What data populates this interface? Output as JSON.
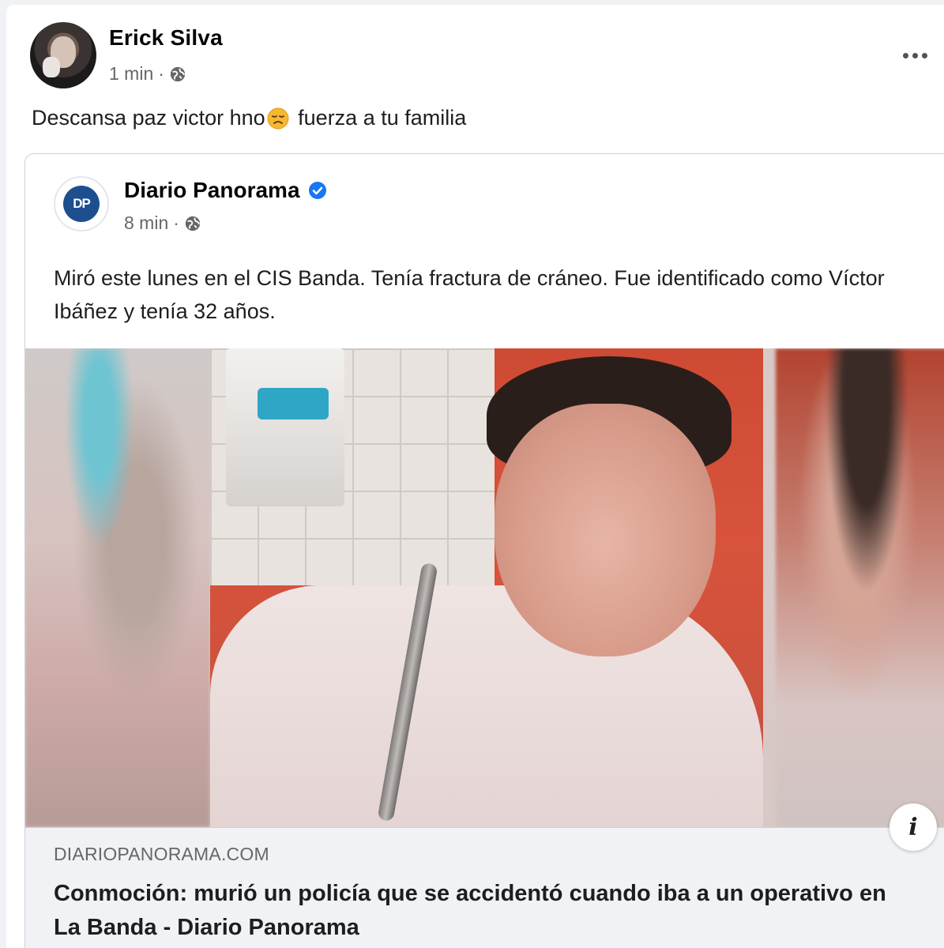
{
  "post": {
    "author_name": "Erick Silva",
    "time": "1 min",
    "separator": "·",
    "text_before_emoji": "Descansa paz victor hno",
    "text_after_emoji": " fuerza a tu familia",
    "emoji_icon": "disappointed-face-emoji",
    "more_icon": "ellipsis-icon"
  },
  "shared": {
    "page_name": "Diario Panorama",
    "page_logo_text": "DP",
    "verified": true,
    "time": "8 min",
    "separator": "·",
    "text": "Miró este lunes en el CIS Banda. Tenía fractura de cráneo. Fue identificado como Víctor Ibáñez y tenía 32 años.",
    "info_label": "i",
    "link": {
      "domain": "DIARIOPANORAMA.COM",
      "title": "Conmoción: murió un policía que se accidentó cuando iba a un operativo en La Banda - Diario Panorama"
    }
  },
  "colors": {
    "verified": "#1877f2",
    "secondary_text": "#65676b",
    "link_bg": "#f0f2f5",
    "logo_bg": "#1d4f8f"
  }
}
